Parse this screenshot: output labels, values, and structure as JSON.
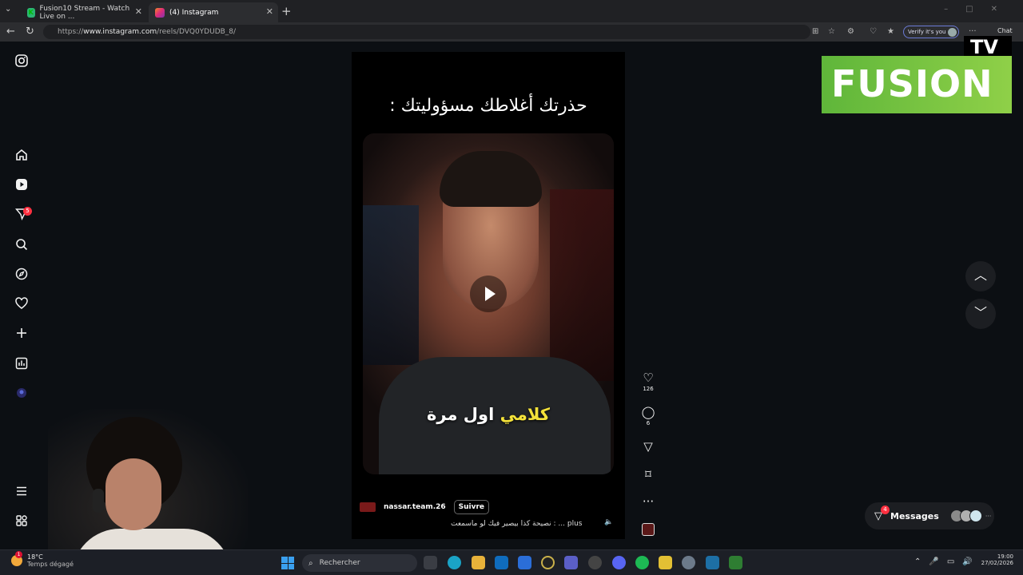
{
  "browser": {
    "tabs": [
      {
        "title": "Fusion10 Stream - Watch Live on ..."
      },
      {
        "title": "(4) Instagram"
      }
    ],
    "url_prefix": "https://",
    "url_host": "www.instagram.com",
    "url_path": "/reels/DVQ0YDUDB_8/",
    "verify_label": "Verify it's you",
    "chat_label": "Chat"
  },
  "sidebar": {
    "notification_count": "5"
  },
  "reel": {
    "caption": "حذرتك أغلاطك مسؤوليتك :",
    "subtitle_highlight": "كلامي",
    "subtitle_rest": "اول مرة",
    "author": "nassar.team.26",
    "follow_label": "Suivre",
    "description": "نصيحة كذا بيصير فيك لو ماسمعت : ... plus",
    "likes": "126",
    "comments": "6"
  },
  "overlay": {
    "fusion_text": "FUSION",
    "tv_text": "TV"
  },
  "messages": {
    "label": "Messages",
    "badge": "4",
    "more": "···"
  },
  "taskbar": {
    "temperature": "18°C",
    "weather_desc": "Temps dégagé",
    "weather_badge": "1",
    "search_placeholder": "Rechercher",
    "time": "19:00",
    "date": "27/02/2026"
  },
  "colors": {
    "accent_notification": "#ff3040",
    "fusion_green": "#5fb63a",
    "subtitle_highlight": "#f4e23a"
  }
}
